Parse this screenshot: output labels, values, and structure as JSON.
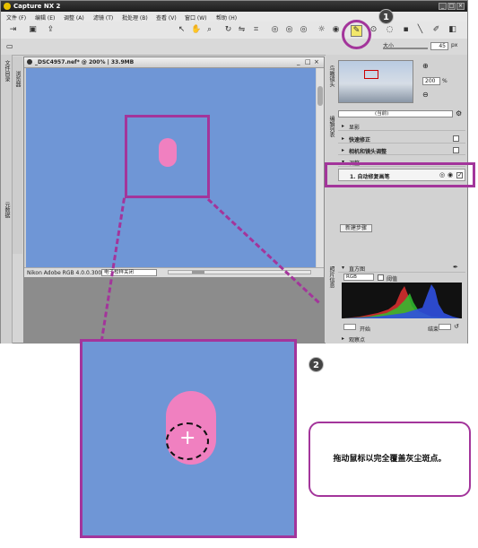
{
  "app": {
    "title": "Capture NX 2"
  },
  "menu": [
    "文件 (F)",
    "编辑 (E)",
    "调整 (A)",
    "滤镜 (T)",
    "批处理 (B)",
    "查看 (V)",
    "窗口 (W)",
    "帮助 (H)"
  ],
  "toolbar": {
    "size_label": "大小",
    "size_value": "45",
    "size_unit": "px"
  },
  "left_tabs": {
    "file_dir": "文件目录",
    "metadata": "元数据",
    "browser": "浏览器"
  },
  "document": {
    "title": "_DSC4957.nef* @ 200% | 33.9MB",
    "color_profile": "Nikon Adobe RGB 4.0.0.3000",
    "dropdown": "电子校样关闭"
  },
  "birdseye": {
    "label": "鸟瞰镜头",
    "zoom": "200",
    "unit": "%"
  },
  "edit_list": {
    "vtab": "编辑列表",
    "version": "(当前)",
    "develop": "显影",
    "quick_fix": "快速修正",
    "camera_lens": "相机和镜头调整",
    "adjust": "调整",
    "step": "1. 自动修复画笔",
    "new_step": "新建步骤"
  },
  "photo_info": {
    "vtab": "照片信息",
    "histogram": "直方图",
    "channel": "RGB",
    "threshold": "阈值",
    "start_label": "开始",
    "end_label": "结束",
    "watch_point": "观察点"
  },
  "annotations": {
    "badge1": "1",
    "badge2": "2"
  },
  "callout": {
    "text": "拖动鼠标以完全覆盖灰尘斑点。"
  },
  "colors": {
    "highlight": "#a3359b",
    "sky": "#6f96d6",
    "spot": "#f080c0"
  }
}
